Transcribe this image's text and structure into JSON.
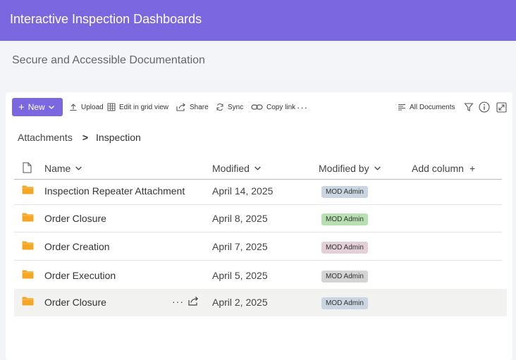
{
  "app": {
    "title": "Interactive Inspection Dashboards",
    "subtitle": "Secure and Accessible Documentation"
  },
  "toolbar": {
    "new_label": "New",
    "upload_label": "Upload",
    "grid_label": "Edit in grid view",
    "share_label": "Share",
    "sync_label": "Sync",
    "copy_link_label": "Copy link",
    "view_label": "All Documents"
  },
  "breadcrumb": {
    "parent": "Attachments",
    "separator": ">",
    "current": "Inspection"
  },
  "columns": {
    "name": "Name",
    "modified": "Modified",
    "modified_by": "Modified by",
    "add_column": "Add column",
    "add_symbol": "+"
  },
  "rows": [
    {
      "name": "Inspection Repeater Attachment",
      "modified": "April 14, 2025",
      "modified_by": "MOD Admin",
      "badge_color": "#c9d5e0"
    },
    {
      "name": "Order Closure",
      "modified": "April 8, 2025",
      "modified_by": "MOD Admin",
      "badge_color": "#b7dfb1"
    },
    {
      "name": "Order Creation",
      "modified": "April 7, 2025",
      "modified_by": "MOD Admin",
      "badge_color": "#e2cfd7"
    },
    {
      "name": "Order Execution",
      "modified": "April 5, 2025",
      "modified_by": "MOD Admin",
      "badge_color": "#d4d4d4"
    },
    {
      "name": "Order Closure",
      "modified": "April 2, 2025",
      "modified_by": "MOD Admin",
      "badge_color": "#c9d5e0"
    }
  ],
  "colors": {
    "accent": "#7b68e0",
    "folder": "#f5a623",
    "hover_row": "#f2f2f1"
  }
}
